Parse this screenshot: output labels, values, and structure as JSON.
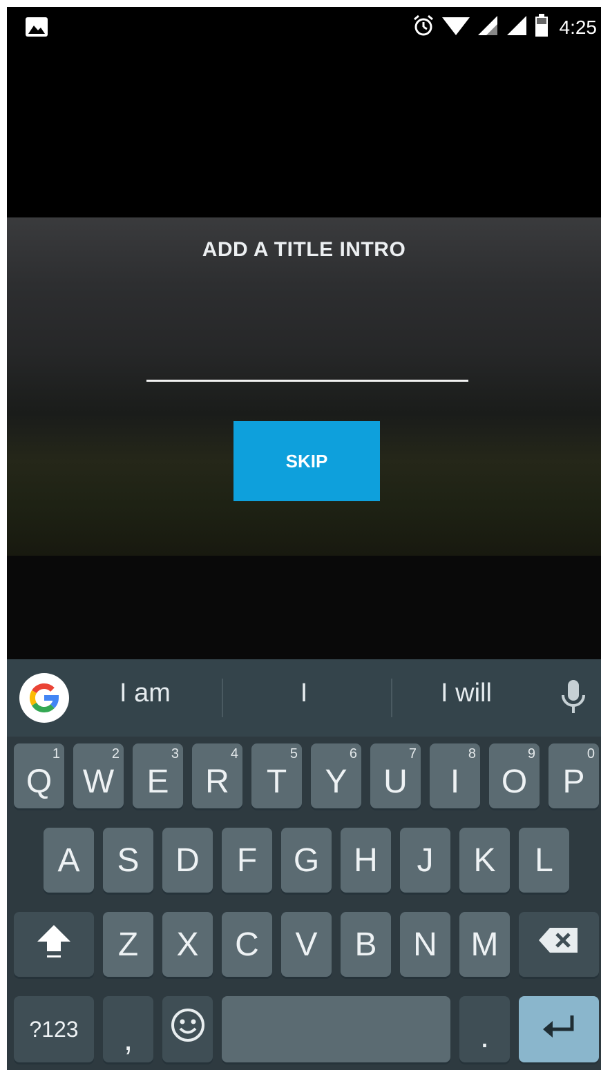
{
  "status_bar": {
    "time": "4:25",
    "left_icon": "image-icon",
    "right_icons": [
      "alarm-icon",
      "wifi-icon",
      "signal-icon",
      "signal-icon",
      "battery-icon"
    ]
  },
  "video_overlay": {
    "title": "ADD A TITLE INTRO",
    "title_input_value": "",
    "skip_label": "SKIP"
  },
  "keyboard": {
    "suggestions": [
      "I am",
      "I",
      "I will"
    ],
    "row1": [
      {
        "label": "Q",
        "hint": "1"
      },
      {
        "label": "W",
        "hint": "2"
      },
      {
        "label": "E",
        "hint": "3"
      },
      {
        "label": "R",
        "hint": "4"
      },
      {
        "label": "T",
        "hint": "5"
      },
      {
        "label": "Y",
        "hint": "6"
      },
      {
        "label": "U",
        "hint": "7"
      },
      {
        "label": "I",
        "hint": "8"
      },
      {
        "label": "O",
        "hint": "9"
      },
      {
        "label": "P",
        "hint": "0"
      }
    ],
    "row2": [
      "A",
      "S",
      "D",
      "F",
      "G",
      "H",
      "J",
      "K",
      "L"
    ],
    "row3": [
      "Z",
      "X",
      "C",
      "V",
      "B",
      "N",
      "M"
    ],
    "symbols_label": "?123",
    "comma_label": ",",
    "period_label": "."
  },
  "colors": {
    "skip_button": "#0ea0dc",
    "keyboard_bg": "#2e3a40",
    "key_bg": "#5b6b72",
    "enter_key": "#8ab6cc"
  }
}
